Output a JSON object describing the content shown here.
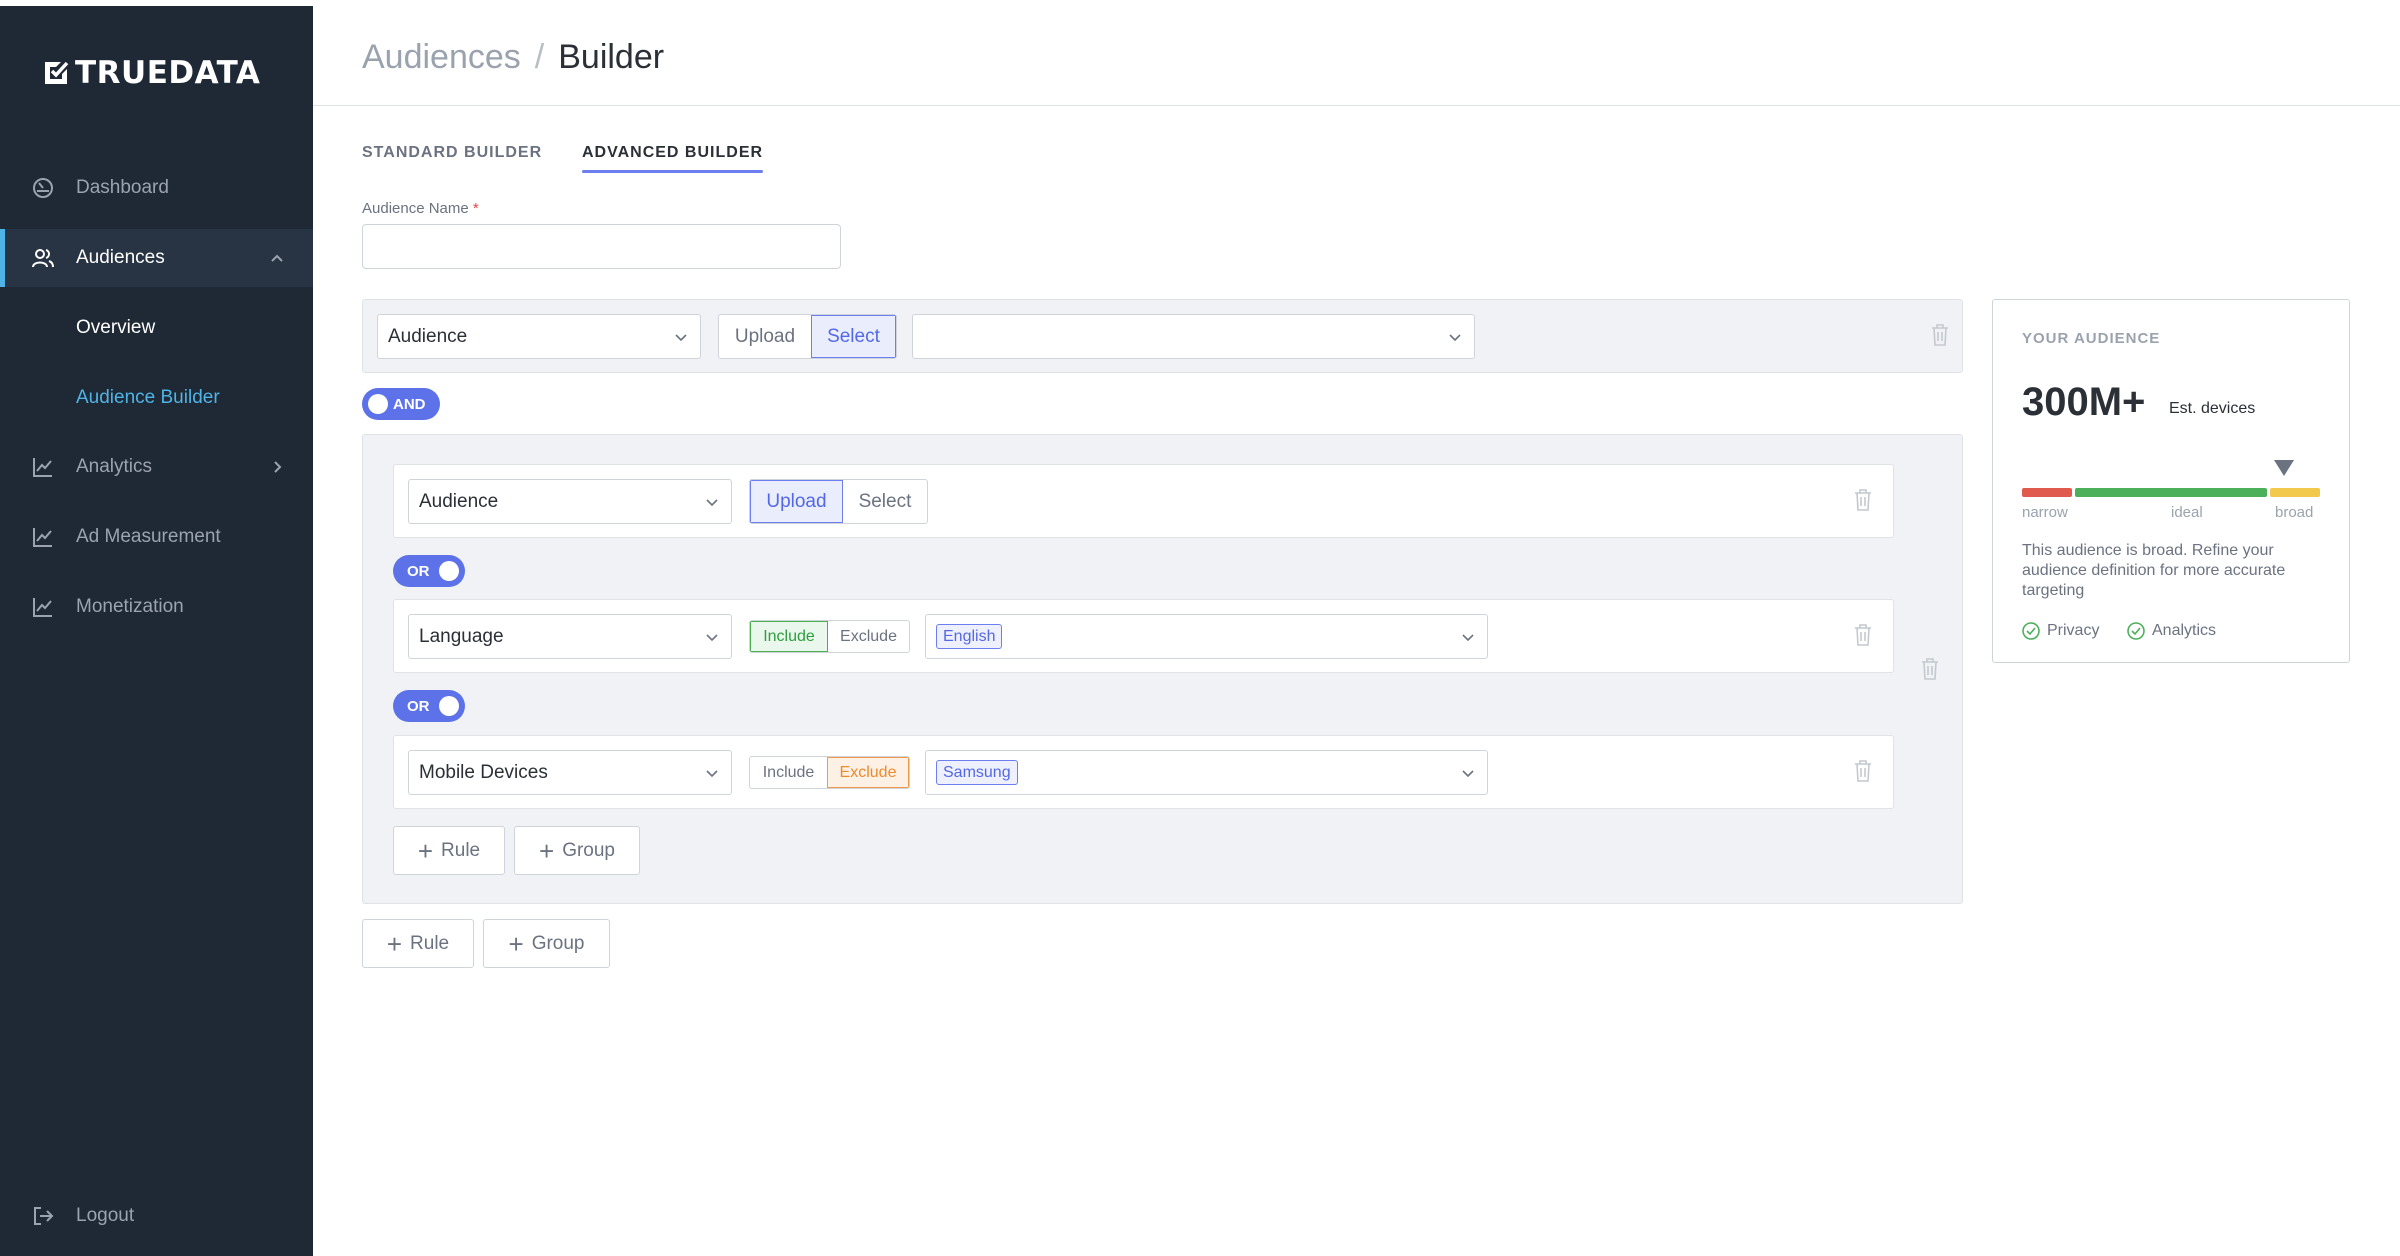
{
  "app": {
    "brand": "TRUEDATA"
  },
  "sidebar": {
    "items": [
      {
        "label": "Dashboard",
        "icon": "dashboard-icon"
      },
      {
        "label": "Audiences",
        "icon": "audiences-icon",
        "expanded": true
      },
      {
        "label": "Analytics",
        "icon": "analytics-icon"
      },
      {
        "label": "Ad Measurement",
        "icon": "ad-measurement-icon"
      },
      {
        "label": "Monetization",
        "icon": "monetization-icon"
      }
    ],
    "sub_items": [
      {
        "label": "Overview"
      },
      {
        "label": "Audience Builder",
        "current": true
      }
    ],
    "logout": "Logout"
  },
  "header": {
    "crumb_parent": "Audiences",
    "crumb_separator": "/",
    "crumb_current": "Builder"
  },
  "tabs": [
    {
      "label": "STANDARD BUILDER",
      "active": false
    },
    {
      "label": "ADVANCED BUILDER",
      "active": true
    }
  ],
  "form": {
    "name_label": "Audience Name",
    "required_mark": "*",
    "name_value": ""
  },
  "builder": {
    "top_rule": {
      "field": "Audience",
      "mode_options": [
        "Upload",
        "Select"
      ],
      "mode_selected": "Select",
      "value": ""
    },
    "top_operator": "AND",
    "group": {
      "rules": [
        {
          "field": "Audience",
          "mode_options": [
            "Upload",
            "Select"
          ],
          "mode_selected": "Upload"
        },
        {
          "operator": "OR"
        },
        {
          "field": "Language",
          "mode_options": [
            "Include",
            "Exclude"
          ],
          "mode_selected": "Include",
          "chip": "English"
        },
        {
          "operator": "OR"
        },
        {
          "field": "Mobile Devices",
          "mode_options": [
            "Include",
            "Exclude"
          ],
          "mode_selected": "Exclude",
          "chip": "Samsung"
        }
      ],
      "add_rule": "Rule",
      "add_group": "Group"
    },
    "add_rule": "Rule",
    "add_group": "Group"
  },
  "audience_card": {
    "title": "YOUR AUDIENCE",
    "count": "300M+",
    "unit": "Est. devices",
    "gauge_labels": [
      "narrow",
      "ideal",
      "broad"
    ],
    "gauge_level": 0.88,
    "colors": {
      "narrow": "#e05a4e",
      "ideal": "#4caf5a",
      "broad": "#f2c94c"
    },
    "note": "This audience is broad. Refine your audience definition for more accurate targeting",
    "flags": [
      "Privacy",
      "Analytics"
    ]
  },
  "colors": {
    "sidebar_bg": "#1f2935",
    "accent": "#4fb3e6",
    "primary": "#5d72e8"
  }
}
